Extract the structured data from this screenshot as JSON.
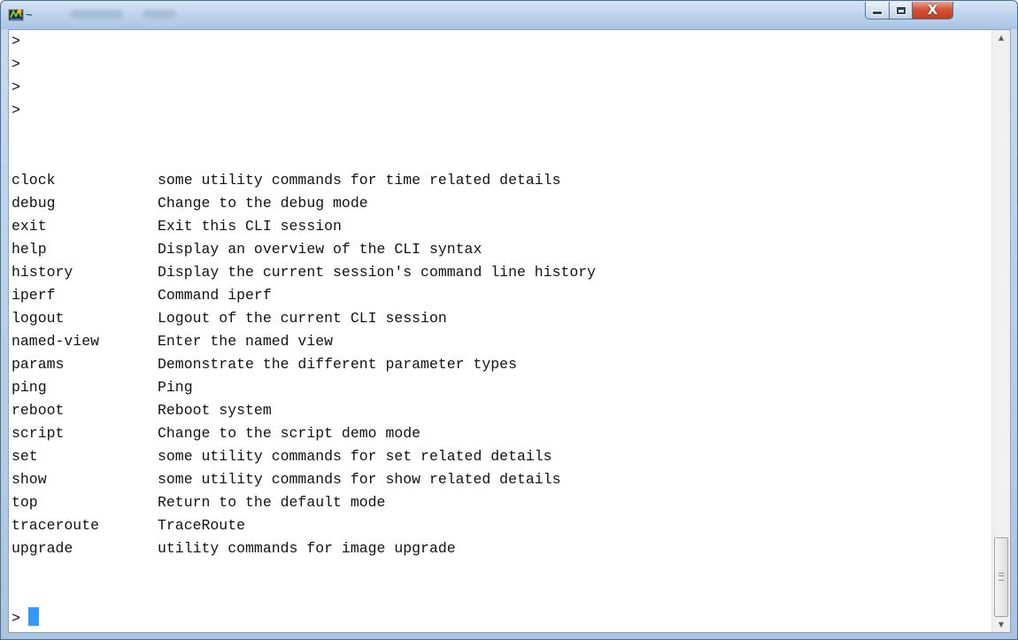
{
  "window": {
    "title": "~",
    "icon": "cygwin-terminal-icon",
    "controls": {
      "minimize_icon": "minimize-icon",
      "maximize_icon": "maximize-icon",
      "close_icon": "close-icon",
      "close_glyph": "X"
    }
  },
  "terminal": {
    "prompts": [
      ">",
      ">",
      ">",
      ">"
    ],
    "commands": [
      {
        "name": "clock",
        "description": "some utility commands for time related details"
      },
      {
        "name": "debug",
        "description": "Change to the debug mode"
      },
      {
        "name": "exit",
        "description": "Exit this CLI session"
      },
      {
        "name": "help",
        "description": "Display an overview of the CLI syntax"
      },
      {
        "name": "history",
        "description": "Display the current session's command line history"
      },
      {
        "name": "iperf",
        "description": "Command iperf"
      },
      {
        "name": "logout",
        "description": "Logout of the current CLI session"
      },
      {
        "name": "named-view",
        "description": "Enter the named view"
      },
      {
        "name": "params",
        "description": "Demonstrate the different parameter types"
      },
      {
        "name": "ping",
        "description": "Ping"
      },
      {
        "name": "reboot",
        "description": "Reboot system"
      },
      {
        "name": "script",
        "description": "Change to the script demo mode"
      },
      {
        "name": "set",
        "description": "some utility commands for set related details"
      },
      {
        "name": "show",
        "description": "some utility commands for show related details"
      },
      {
        "name": "top",
        "description": "Return to the default mode"
      },
      {
        "name": "traceroute",
        "description": "TraceRoute"
      },
      {
        "name": "upgrade",
        "description": "utility commands for image upgrade"
      }
    ],
    "current_prompt": ">",
    "cursor_color": "#3399ff"
  },
  "scrollbar": {
    "up_glyph": "▲",
    "down_glyph": "▼"
  }
}
